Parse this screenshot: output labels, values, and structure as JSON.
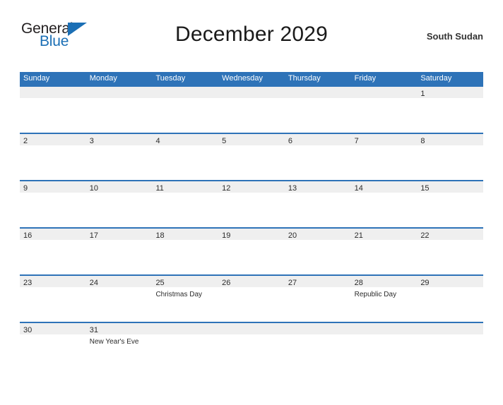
{
  "brand": {
    "name_part1": "General",
    "name_part2": "Blue",
    "flag_icon": "triangle-flag-icon"
  },
  "header": {
    "title": "December 2029",
    "region": "South Sudan"
  },
  "colors": {
    "header_blue": "#2e73b8",
    "band_gray": "#efefef",
    "brand_blue": "#1b6fb5",
    "text_dark": "#2b2b2b"
  },
  "calendar": {
    "month": "December",
    "year": 2029,
    "weekday_headers": [
      "Sunday",
      "Monday",
      "Tuesday",
      "Wednesday",
      "Thursday",
      "Friday",
      "Saturday"
    ],
    "weeks": [
      [
        {
          "day": "",
          "event": ""
        },
        {
          "day": "",
          "event": ""
        },
        {
          "day": "",
          "event": ""
        },
        {
          "day": "",
          "event": ""
        },
        {
          "day": "",
          "event": ""
        },
        {
          "day": "",
          "event": ""
        },
        {
          "day": "1",
          "event": ""
        }
      ],
      [
        {
          "day": "2",
          "event": ""
        },
        {
          "day": "3",
          "event": ""
        },
        {
          "day": "4",
          "event": ""
        },
        {
          "day": "5",
          "event": ""
        },
        {
          "day": "6",
          "event": ""
        },
        {
          "day": "7",
          "event": ""
        },
        {
          "day": "8",
          "event": ""
        }
      ],
      [
        {
          "day": "9",
          "event": ""
        },
        {
          "day": "10",
          "event": ""
        },
        {
          "day": "11",
          "event": ""
        },
        {
          "day": "12",
          "event": ""
        },
        {
          "day": "13",
          "event": ""
        },
        {
          "day": "14",
          "event": ""
        },
        {
          "day": "15",
          "event": ""
        }
      ],
      [
        {
          "day": "16",
          "event": ""
        },
        {
          "day": "17",
          "event": ""
        },
        {
          "day": "18",
          "event": ""
        },
        {
          "day": "19",
          "event": ""
        },
        {
          "day": "20",
          "event": ""
        },
        {
          "day": "21",
          "event": ""
        },
        {
          "day": "22",
          "event": ""
        }
      ],
      [
        {
          "day": "23",
          "event": ""
        },
        {
          "day": "24",
          "event": ""
        },
        {
          "day": "25",
          "event": "Christmas Day"
        },
        {
          "day": "26",
          "event": ""
        },
        {
          "day": "27",
          "event": ""
        },
        {
          "day": "28",
          "event": "Republic Day"
        },
        {
          "day": "29",
          "event": ""
        }
      ],
      [
        {
          "day": "30",
          "event": ""
        },
        {
          "day": "31",
          "event": "New Year's Eve"
        },
        {
          "day": "",
          "event": ""
        },
        {
          "day": "",
          "event": ""
        },
        {
          "day": "",
          "event": ""
        },
        {
          "day": "",
          "event": ""
        },
        {
          "day": "",
          "event": ""
        }
      ]
    ]
  }
}
